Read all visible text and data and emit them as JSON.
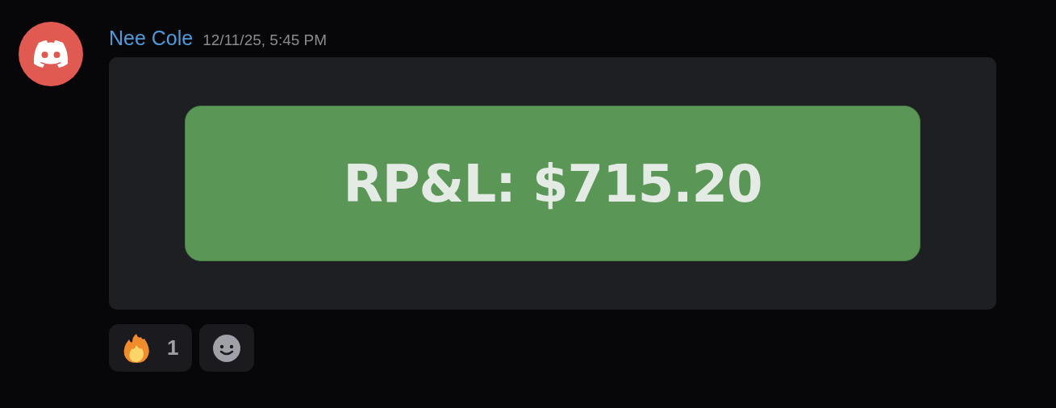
{
  "message": {
    "author": "Nee Cole",
    "timestamp": "12/11/25, 5:45 PM",
    "attachment": {
      "label": "RP&L: $715.20"
    },
    "reactions": [
      {
        "count": "1"
      }
    ]
  }
}
